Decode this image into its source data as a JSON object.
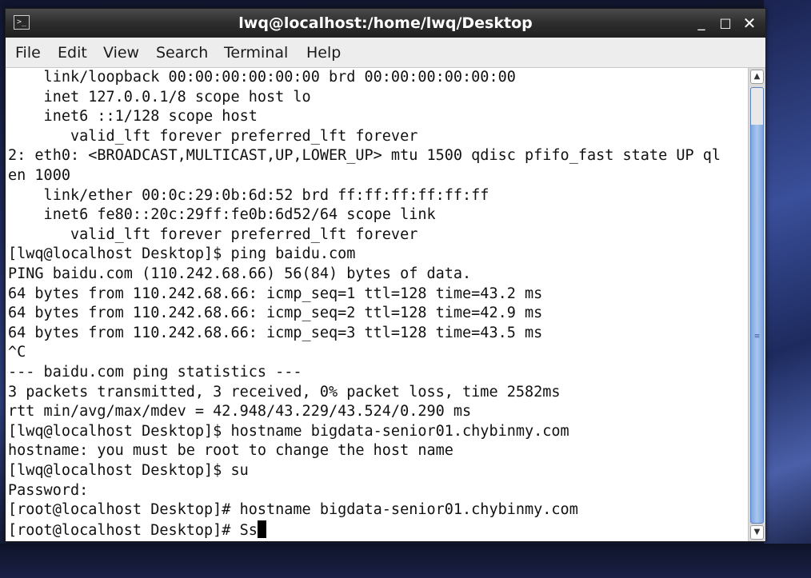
{
  "window": {
    "title": "lwq@localhost:/home/lwq/Desktop",
    "icon": "terminal-icon",
    "controls": {
      "minimize": "_",
      "maximize": "□",
      "close": "✕"
    }
  },
  "menubar": {
    "items": [
      {
        "label": "File"
      },
      {
        "label": "Edit"
      },
      {
        "label": "View"
      },
      {
        "label": "Search"
      },
      {
        "label": "Terminal"
      },
      {
        "label": "Help"
      }
    ]
  },
  "terminal": {
    "lines": [
      "    link/loopback 00:00:00:00:00:00 brd 00:00:00:00:00:00",
      "    inet 127.0.0.1/8 scope host lo",
      "    inet6 ::1/128 scope host",
      "       valid_lft forever preferred_lft forever",
      "2: eth0: <BROADCAST,MULTICAST,UP,LOWER_UP> mtu 1500 qdisc pfifo_fast state UP ql",
      "en 1000",
      "    link/ether 00:0c:29:0b:6d:52 brd ff:ff:ff:ff:ff:ff",
      "    inet6 fe80::20c:29ff:fe0b:6d52/64 scope link",
      "       valid_lft forever preferred_lft forever",
      "[lwq@localhost Desktop]$ ping baidu.com",
      "PING baidu.com (110.242.68.66) 56(84) bytes of data.",
      "64 bytes from 110.242.68.66: icmp_seq=1 ttl=128 time=43.2 ms",
      "64 bytes from 110.242.68.66: icmp_seq=2 ttl=128 time=42.9 ms",
      "64 bytes from 110.242.68.66: icmp_seq=3 ttl=128 time=43.5 ms",
      "^C",
      "--- baidu.com ping statistics ---",
      "3 packets transmitted, 3 received, 0% packet loss, time 2582ms",
      "rtt min/avg/max/mdev = 42.948/43.229/43.524/0.290 ms",
      "[lwq@localhost Desktop]$ hostname bigdata-senior01.chybinmy.com",
      "hostname: you must be root to change the host name",
      "[lwq@localhost Desktop]$ su",
      "Password:",
      "[root@localhost Desktop]# hostname bigdata-senior01.chybinmy.com"
    ],
    "current_prompt": "[root@localhost Desktop]# ",
    "current_input": "Ss"
  },
  "scrollbar": {
    "up_arrow": "▲",
    "down_arrow": "▼",
    "grip": "≡"
  }
}
